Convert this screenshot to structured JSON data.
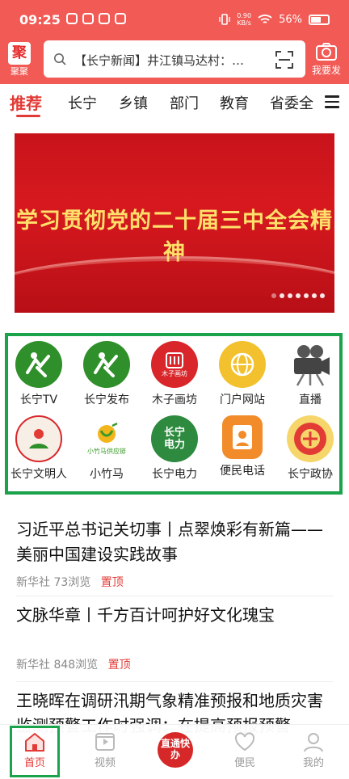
{
  "status": {
    "time": "09:25",
    "net_speed": "0.90",
    "net_unit": "KB/s",
    "battery": "56%"
  },
  "header": {
    "logo_char": "聚",
    "logo_label": "聚聚",
    "search_text": "【长宁新闻】井江镇马达村：…",
    "camera_label": "我要发"
  },
  "tabs": [
    "推荐",
    "长宁",
    "乡镇",
    "部门",
    "教育",
    "省委全"
  ],
  "banner": {
    "title": "学习贯彻党的二十届三中全会精神"
  },
  "shortcuts": [
    {
      "label": "长宁TV",
      "icon": "changning-tv-icon"
    },
    {
      "label": "长宁发布",
      "icon": "changning-release-icon"
    },
    {
      "label": "木子画坊",
      "icon": "muzi-studio-icon",
      "icon_text": "木子画坊"
    },
    {
      "label": "门户网站",
      "icon": "portal-website-icon"
    },
    {
      "label": "直播",
      "icon": "live-camera-icon"
    },
    {
      "label": "长宁文明人",
      "icon": "civilized-person-icon"
    },
    {
      "label": "小竹马",
      "icon": "bamboo-horse-icon",
      "icon_text": "小竹马供应链"
    },
    {
      "label": "长宁电力",
      "icon": "power-icon",
      "icon_text": "长宁电力"
    },
    {
      "label": "便民电话",
      "icon": "phone-book-icon"
    },
    {
      "label": "长宁政协",
      "icon": "cppcc-emblem-icon"
    }
  ],
  "news": [
    {
      "title": "习近平总书记关切事丨点翠焕彩有新篇——美丽中国建设实践故事",
      "source": "新华社",
      "views": "73浏览",
      "pin": "置顶"
    },
    {
      "title": "文脉华章丨千方百计呵护好文化瑰宝",
      "source": "新华社",
      "views": "848浏览",
      "pin": "置顶"
    },
    {
      "title": "王晓晖在调研汛期气象精准预报和地质灾害监测预警工作时强调：在提高预报预警"
    }
  ],
  "bottom_nav": {
    "home": "首页",
    "video": "视频",
    "center": "直通快办",
    "service": "便民",
    "mine": "我的"
  },
  "colors": {
    "brand_red": "#f25a55",
    "accent_red": "#e23a35",
    "highlight_green": "#1aa34a"
  }
}
